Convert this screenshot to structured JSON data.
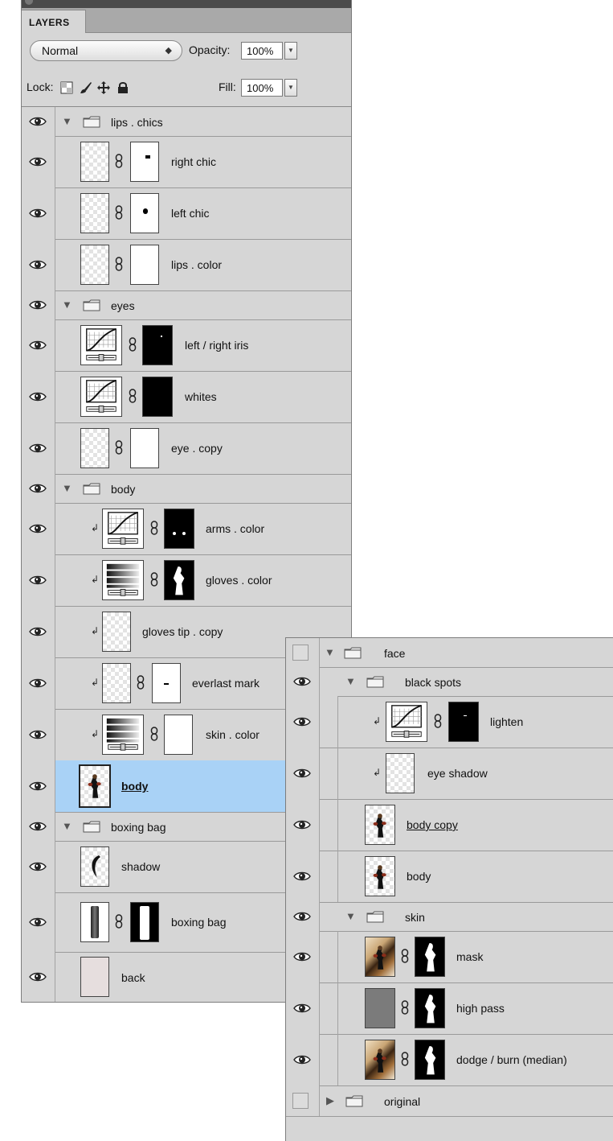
{
  "panel": {
    "tab_label": "LAYERS",
    "blend_mode": "Normal",
    "opacity_label": "Opacity:",
    "opacity_value": "100%",
    "lock_label": "Lock:",
    "fill_label": "Fill:",
    "fill_value": "100%"
  },
  "layers_main": [
    {
      "name": "lips . chics",
      "type": "group",
      "expanded": true,
      "visible": true
    },
    {
      "name": "right chic",
      "type": "pixel-masked",
      "visible": true
    },
    {
      "name": "left chic",
      "type": "pixel-masked",
      "visible": true
    },
    {
      "name": "lips . color",
      "type": "pixel-masked",
      "visible": true
    },
    {
      "name": "eyes",
      "type": "group",
      "expanded": true,
      "visible": true
    },
    {
      "name": "left / right iris",
      "type": "curves-adjustment",
      "visible": true
    },
    {
      "name": "whites",
      "type": "curves-adjustment",
      "visible": true
    },
    {
      "name": "eye . copy",
      "type": "pixel-masked",
      "visible": true
    },
    {
      "name": "body",
      "type": "group",
      "expanded": true,
      "visible": true
    },
    {
      "name": "arms . color",
      "type": "curves-adjustment",
      "clipped": true,
      "visible": true
    },
    {
      "name": "gloves . color",
      "type": "gradient-map-adjustment",
      "clipped": true,
      "visible": true
    },
    {
      "name": "gloves tip . copy",
      "type": "pixel",
      "clipped": true,
      "visible": true
    },
    {
      "name": "everlast mark",
      "type": "pixel-masked",
      "clipped": true,
      "visible": true
    },
    {
      "name": "skin . color",
      "type": "gradient-map-adjustment",
      "clipped": true,
      "visible": true
    },
    {
      "name": "body",
      "type": "smart-object",
      "selected": true,
      "visible": true
    },
    {
      "name": "boxing bag",
      "type": "group",
      "expanded": true,
      "visible": true
    },
    {
      "name": "shadow",
      "type": "pixel",
      "visible": true
    },
    {
      "name": "boxing bag",
      "type": "pixel-masked",
      "visible": true
    },
    {
      "name": "back",
      "type": "pixel",
      "visible": true
    }
  ],
  "layers_face": [
    {
      "name": "face",
      "type": "group",
      "expanded": true,
      "visible": false
    },
    {
      "name": "black spots",
      "type": "group",
      "expanded": true,
      "visible": true
    },
    {
      "name": "lighten",
      "type": "curves-adjustment",
      "clipped": true,
      "visible": true
    },
    {
      "name": "eye shadow",
      "type": "pixel",
      "clipped": true,
      "visible": true
    },
    {
      "name": "body copy",
      "type": "smart-object",
      "visible": true
    },
    {
      "name": "body",
      "type": "pixel",
      "visible": true
    },
    {
      "name": "skin",
      "type": "group",
      "expanded": true,
      "visible": true
    },
    {
      "name": "mask",
      "type": "pixel-masked",
      "visible": true
    },
    {
      "name": "high pass",
      "type": "pixel-masked",
      "visible": true
    },
    {
      "name": "dodge / burn (median)",
      "type": "pixel-masked",
      "visible": true
    },
    {
      "name": "original",
      "type": "group",
      "expanded": false,
      "visible": false
    }
  ]
}
